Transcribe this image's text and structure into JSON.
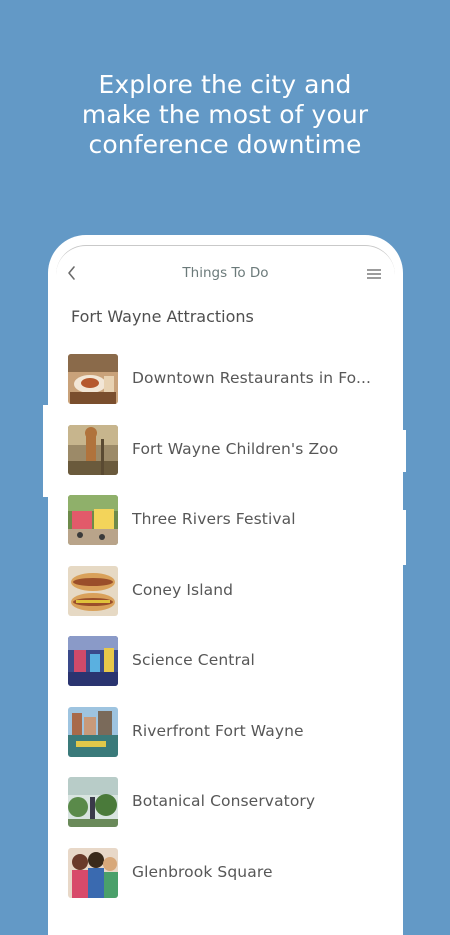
{
  "headline": {
    "line1": "Explore the city and",
    "line2": "make the most of your",
    "line3": "conference downtime"
  },
  "app_bar": {
    "title": "Things To Do",
    "back_icon": "chevron-left-icon",
    "menu_icon": "hamburger-menu-icon"
  },
  "section": {
    "title": "Fort Wayne Attractions"
  },
  "items": [
    {
      "label": "Downtown Restaurants in Fo...",
      "thumb": "restaurant-photo"
    },
    {
      "label": "Fort Wayne Children's Zoo",
      "thumb": "zoo-photo"
    },
    {
      "label": "Three Rivers Festival",
      "thumb": "festival-photo"
    },
    {
      "label": "Coney Island",
      "thumb": "hotdog-photo"
    },
    {
      "label": "Science Central",
      "thumb": "science-photo"
    },
    {
      "label": "Riverfront Fort Wayne",
      "thumb": "riverfront-photo"
    },
    {
      "label": "Botanical Conservatory",
      "thumb": "conservatory-photo"
    },
    {
      "label": "Glenbrook Square",
      "thumb": "mall-photo"
    }
  ],
  "colors": {
    "background": "#6399c6",
    "card": "#ffffff",
    "text": "#575757",
    "title": "#6b7a7a"
  }
}
